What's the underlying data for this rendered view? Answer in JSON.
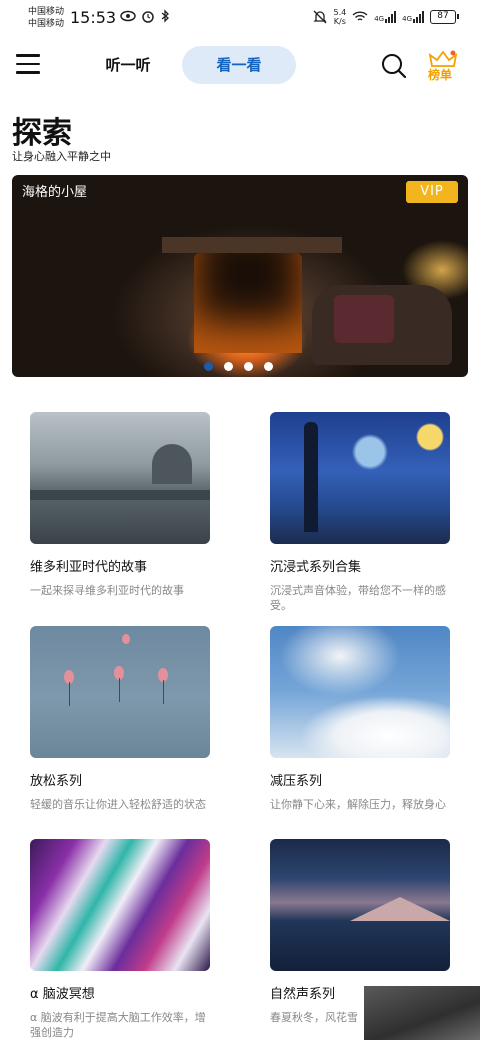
{
  "status_bar": {
    "carrier_1": "中国移动",
    "carrier_2": "中国移动",
    "time": "15:53",
    "net_speed_value": "5.4",
    "net_speed_unit": "K/s",
    "signal_1": "4G",
    "signal_2": "4G",
    "battery": "87"
  },
  "top_nav": {
    "tab_listen": "听一听",
    "tab_watch": "看一看",
    "rank_label": "榜单",
    "active_tab": "看一看",
    "accent_color": "#1565c0",
    "rank_color": "#f5a000"
  },
  "header": {
    "title": "探索",
    "subtitle": "让身心融入平静之中"
  },
  "banner": {
    "title": "海格的小屋",
    "badge": "VIP",
    "badge_color": "#f2b51d",
    "slide_count": 4,
    "active_slide": 1
  },
  "cards": [
    {
      "title": "维多利亚时代的故事",
      "desc": "一起来探寻维多利亚时代的故事"
    },
    {
      "title": "沉浸式系列合集",
      "desc": "沉浸式声音体验，带给您不一样的感受。"
    },
    {
      "title": "放松系列",
      "desc": "轻缓的音乐让你进入轻松舒适的状态"
    },
    {
      "title": "减压系列",
      "desc": "让你静下心来，解除压力，释放身心"
    },
    {
      "title": "α 脑波冥想",
      "desc": "α 脑波有利于提高大脑工作效率，增强创造力"
    },
    {
      "title": "自然声系列",
      "desc": "春夏秋冬，风花雪"
    }
  ]
}
